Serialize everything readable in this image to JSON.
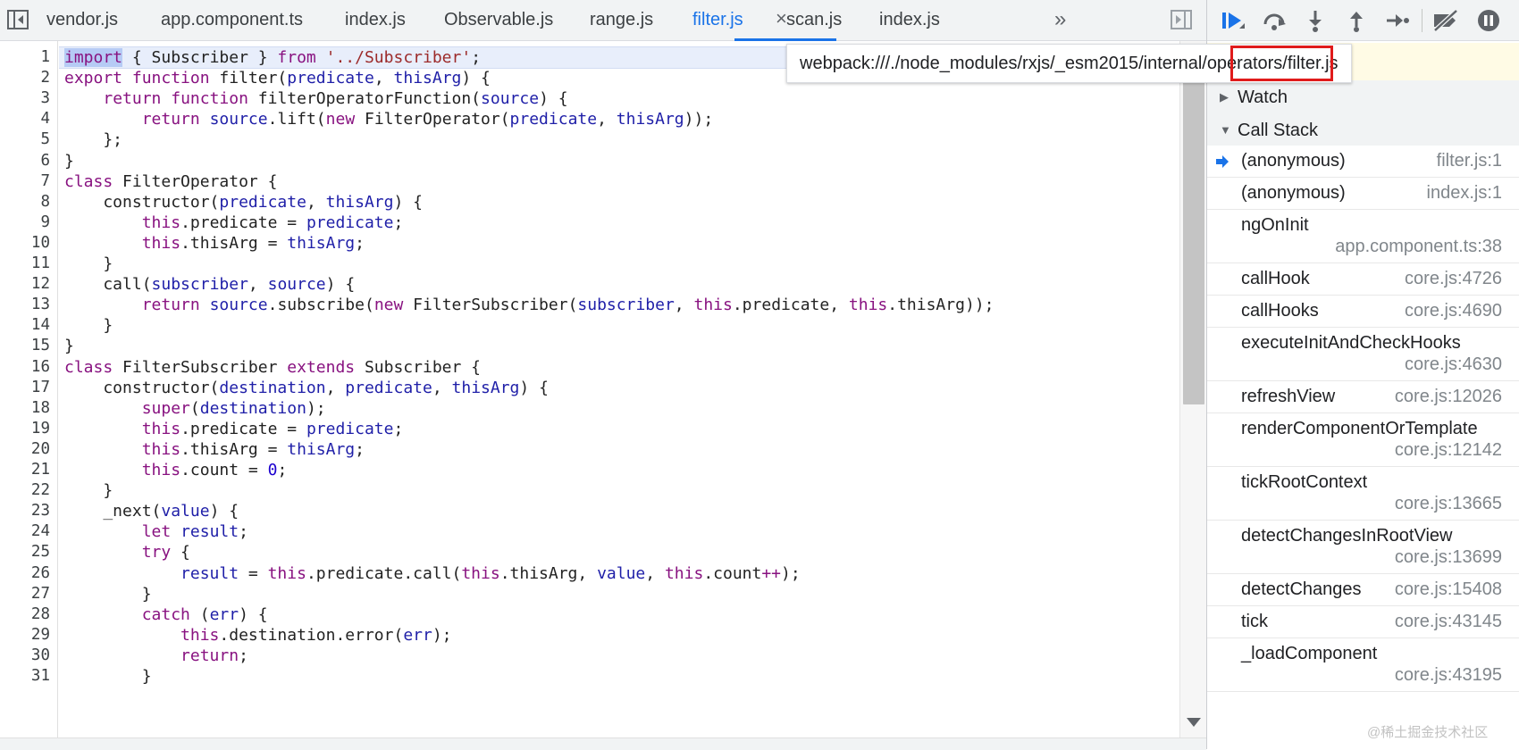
{
  "tabs": [
    {
      "label": "vendor.js",
      "active": false
    },
    {
      "label": "app.component.ts",
      "active": false
    },
    {
      "label": "index.js",
      "active": false
    },
    {
      "label": "Observable.js",
      "active": false
    },
    {
      "label": "range.js",
      "active": false
    },
    {
      "label": "filter.js",
      "active": true
    },
    {
      "label": "scan.js",
      "active": false
    },
    {
      "label": "index.js",
      "active": false
    }
  ],
  "tab_close_glyph": "×",
  "more_tabs_glyph": "»",
  "tooltip": {
    "path_prefix": "webpack:///./node_modules/rxjs/_esm2015/interna",
    "path_highlighted": "l/operators/f",
    "path_suffix": "ilter.js"
  },
  "line_numbers": [
    "1",
    "2",
    "3",
    "4",
    "5",
    "6",
    "7",
    "8",
    "9",
    "10",
    "11",
    "12",
    "13",
    "14",
    "15",
    "16",
    "17",
    "18",
    "19",
    "20",
    "21",
    "22",
    "23",
    "24",
    "25",
    "26",
    "27",
    "28",
    "29",
    "30",
    "31"
  ],
  "code": [
    [
      {
        "t": "import",
        "c": "kw sel"
      },
      {
        "t": " { Subscriber } ",
        "c": ""
      },
      {
        "t": "from",
        "c": "kw"
      },
      {
        "t": " ",
        "c": ""
      },
      {
        "t": "'../Subscriber'",
        "c": "st"
      },
      {
        "t": ";",
        "c": ""
      }
    ],
    [
      {
        "t": "export",
        "c": "kw"
      },
      {
        "t": " ",
        "c": ""
      },
      {
        "t": "function",
        "c": "kw"
      },
      {
        "t": " filter(",
        "c": ""
      },
      {
        "t": "predicate",
        "c": "vr"
      },
      {
        "t": ", ",
        "c": ""
      },
      {
        "t": "thisArg",
        "c": "vr"
      },
      {
        "t": ") {",
        "c": ""
      }
    ],
    [
      {
        "t": "    ",
        "c": ""
      },
      {
        "t": "return",
        "c": "kw"
      },
      {
        "t": " ",
        "c": ""
      },
      {
        "t": "function",
        "c": "kw"
      },
      {
        "t": " filterOperatorFunction(",
        "c": ""
      },
      {
        "t": "source",
        "c": "vr"
      },
      {
        "t": ") {",
        "c": ""
      }
    ],
    [
      {
        "t": "        ",
        "c": ""
      },
      {
        "t": "return",
        "c": "kw"
      },
      {
        "t": " ",
        "c": ""
      },
      {
        "t": "source",
        "c": "vr"
      },
      {
        "t": ".lift(",
        "c": ""
      },
      {
        "t": "new",
        "c": "kw"
      },
      {
        "t": " FilterOperator(",
        "c": ""
      },
      {
        "t": "predicate",
        "c": "vr"
      },
      {
        "t": ", ",
        "c": ""
      },
      {
        "t": "thisArg",
        "c": "vr"
      },
      {
        "t": "));",
        "c": ""
      }
    ],
    [
      {
        "t": "    };",
        "c": ""
      }
    ],
    [
      {
        "t": "}",
        "c": ""
      }
    ],
    [
      {
        "t": "class",
        "c": "kw"
      },
      {
        "t": " FilterOperator {",
        "c": ""
      }
    ],
    [
      {
        "t": "    constructor(",
        "c": ""
      },
      {
        "t": "predicate",
        "c": "vr"
      },
      {
        "t": ", ",
        "c": ""
      },
      {
        "t": "thisArg",
        "c": "vr"
      },
      {
        "t": ") {",
        "c": ""
      }
    ],
    [
      {
        "t": "        ",
        "c": ""
      },
      {
        "t": "this",
        "c": "kw"
      },
      {
        "t": ".predicate = ",
        "c": ""
      },
      {
        "t": "predicate",
        "c": "vr"
      },
      {
        "t": ";",
        "c": ""
      }
    ],
    [
      {
        "t": "        ",
        "c": ""
      },
      {
        "t": "this",
        "c": "kw"
      },
      {
        "t": ".thisArg = ",
        "c": ""
      },
      {
        "t": "thisArg",
        "c": "vr"
      },
      {
        "t": ";",
        "c": ""
      }
    ],
    [
      {
        "t": "    }",
        "c": ""
      }
    ],
    [
      {
        "t": "    call(",
        "c": ""
      },
      {
        "t": "subscriber",
        "c": "vr"
      },
      {
        "t": ", ",
        "c": ""
      },
      {
        "t": "source",
        "c": "vr"
      },
      {
        "t": ") {",
        "c": ""
      }
    ],
    [
      {
        "t": "        ",
        "c": ""
      },
      {
        "t": "return",
        "c": "kw"
      },
      {
        "t": " ",
        "c": ""
      },
      {
        "t": "source",
        "c": "vr"
      },
      {
        "t": ".subscribe(",
        "c": ""
      },
      {
        "t": "new",
        "c": "kw"
      },
      {
        "t": " FilterSubscriber(",
        "c": ""
      },
      {
        "t": "subscriber",
        "c": "vr"
      },
      {
        "t": ", ",
        "c": ""
      },
      {
        "t": "this",
        "c": "kw"
      },
      {
        "t": ".predicate, ",
        "c": ""
      },
      {
        "t": "this",
        "c": "kw"
      },
      {
        "t": ".thisArg));",
        "c": ""
      }
    ],
    [
      {
        "t": "    }",
        "c": ""
      }
    ],
    [
      {
        "t": "}",
        "c": ""
      }
    ],
    [
      {
        "t": "class",
        "c": "kw"
      },
      {
        "t": " FilterSubscriber ",
        "c": ""
      },
      {
        "t": "extends",
        "c": "kw"
      },
      {
        "t": " Subscriber {",
        "c": ""
      }
    ],
    [
      {
        "t": "    constructor(",
        "c": ""
      },
      {
        "t": "destination",
        "c": "vr"
      },
      {
        "t": ", ",
        "c": ""
      },
      {
        "t": "predicate",
        "c": "vr"
      },
      {
        "t": ", ",
        "c": ""
      },
      {
        "t": "thisArg",
        "c": "vr"
      },
      {
        "t": ") {",
        "c": ""
      }
    ],
    [
      {
        "t": "        ",
        "c": ""
      },
      {
        "t": "super",
        "c": "kw"
      },
      {
        "t": "(",
        "c": ""
      },
      {
        "t": "destination",
        "c": "vr"
      },
      {
        "t": ");",
        "c": ""
      }
    ],
    [
      {
        "t": "        ",
        "c": ""
      },
      {
        "t": "this",
        "c": "kw"
      },
      {
        "t": ".predicate = ",
        "c": ""
      },
      {
        "t": "predicate",
        "c": "vr"
      },
      {
        "t": ";",
        "c": ""
      }
    ],
    [
      {
        "t": "        ",
        "c": ""
      },
      {
        "t": "this",
        "c": "kw"
      },
      {
        "t": ".thisArg = ",
        "c": ""
      },
      {
        "t": "thisArg",
        "c": "vr"
      },
      {
        "t": ";",
        "c": ""
      }
    ],
    [
      {
        "t": "        ",
        "c": ""
      },
      {
        "t": "this",
        "c": "kw"
      },
      {
        "t": ".count = ",
        "c": ""
      },
      {
        "t": "0",
        "c": "nm"
      },
      {
        "t": ";",
        "c": ""
      }
    ],
    [
      {
        "t": "    }",
        "c": ""
      }
    ],
    [
      {
        "t": "    _next(",
        "c": ""
      },
      {
        "t": "value",
        "c": "vr"
      },
      {
        "t": ") {",
        "c": ""
      }
    ],
    [
      {
        "t": "        ",
        "c": ""
      },
      {
        "t": "let",
        "c": "kw"
      },
      {
        "t": " ",
        "c": ""
      },
      {
        "t": "result",
        "c": "vr"
      },
      {
        "t": ";",
        "c": ""
      }
    ],
    [
      {
        "t": "        ",
        "c": ""
      },
      {
        "t": "try",
        "c": "kw"
      },
      {
        "t": " {",
        "c": ""
      }
    ],
    [
      {
        "t": "            ",
        "c": ""
      },
      {
        "t": "result",
        "c": "vr"
      },
      {
        "t": " = ",
        "c": ""
      },
      {
        "t": "this",
        "c": "kw"
      },
      {
        "t": ".predicate.call(",
        "c": ""
      },
      {
        "t": "this",
        "c": "kw"
      },
      {
        "t": ".thisArg, ",
        "c": ""
      },
      {
        "t": "value",
        "c": "vr"
      },
      {
        "t": ", ",
        "c": ""
      },
      {
        "t": "this",
        "c": "kw"
      },
      {
        "t": ".count",
        "c": ""
      },
      {
        "t": "++",
        "c": "kw"
      },
      {
        "t": ");",
        "c": ""
      }
    ],
    [
      {
        "t": "        }",
        "c": ""
      }
    ],
    [
      {
        "t": "        ",
        "c": ""
      },
      {
        "t": "catch",
        "c": "kw"
      },
      {
        "t": " (",
        "c": ""
      },
      {
        "t": "err",
        "c": "vr"
      },
      {
        "t": ") {",
        "c": ""
      }
    ],
    [
      {
        "t": "            ",
        "c": ""
      },
      {
        "t": "this",
        "c": "kw"
      },
      {
        "t": ".destination.error(",
        "c": ""
      },
      {
        "t": "err",
        "c": "vr"
      },
      {
        "t": ");",
        "c": ""
      }
    ],
    [
      {
        "t": "            ",
        "c": ""
      },
      {
        "t": "return",
        "c": "kw"
      },
      {
        "t": ";",
        "c": ""
      }
    ],
    [
      {
        "t": "        }",
        "c": ""
      }
    ]
  ],
  "debugger": {
    "toolbar_icons": [
      "resume-icon",
      "step-over-icon",
      "step-into-icon",
      "step-out-icon",
      "step-icon",
      "deactivate-breakpoints-icon",
      "pause-on-exceptions-icon"
    ],
    "sections": {
      "watch": {
        "label": "Watch",
        "expanded": false
      },
      "call_stack": {
        "label": "Call Stack",
        "expanded": true
      }
    },
    "call_stack": [
      {
        "fn": "(anonymous)",
        "loc": "filter.js:1",
        "current": true
      },
      {
        "fn": "(anonymous)",
        "loc": "index.js:1",
        "current": false
      },
      {
        "fn": "ngOnInit",
        "loc": "app.component.ts:38",
        "current": false
      },
      {
        "fn": "callHook",
        "loc": "core.js:4726",
        "current": false
      },
      {
        "fn": "callHooks",
        "loc": "core.js:4690",
        "current": false
      },
      {
        "fn": "executeInitAndCheckHooks",
        "loc": "core.js:4630",
        "current": false
      },
      {
        "fn": "refreshView",
        "loc": "core.js:12026",
        "current": false
      },
      {
        "fn": "renderComponentOrTemplate",
        "loc": "core.js:12142",
        "current": false
      },
      {
        "fn": "tickRootContext",
        "loc": "core.js:13665",
        "current": false
      },
      {
        "fn": "detectChangesInRootView",
        "loc": "core.js:13699",
        "current": false
      },
      {
        "fn": "detectChanges",
        "loc": "core.js:15408",
        "current": false
      },
      {
        "fn": "tick",
        "loc": "core.js:43145",
        "current": false
      },
      {
        "fn": "_loadComponent",
        "loc": "core.js:43195",
        "current": false
      }
    ]
  },
  "watermark": "@稀土掘金技术社区",
  "colors": {
    "accent": "#1a73e8",
    "highlight_box": "#e01b1b",
    "keyword": "#881280",
    "variable": "#1f1fa8",
    "string": "#9c2a2a"
  }
}
